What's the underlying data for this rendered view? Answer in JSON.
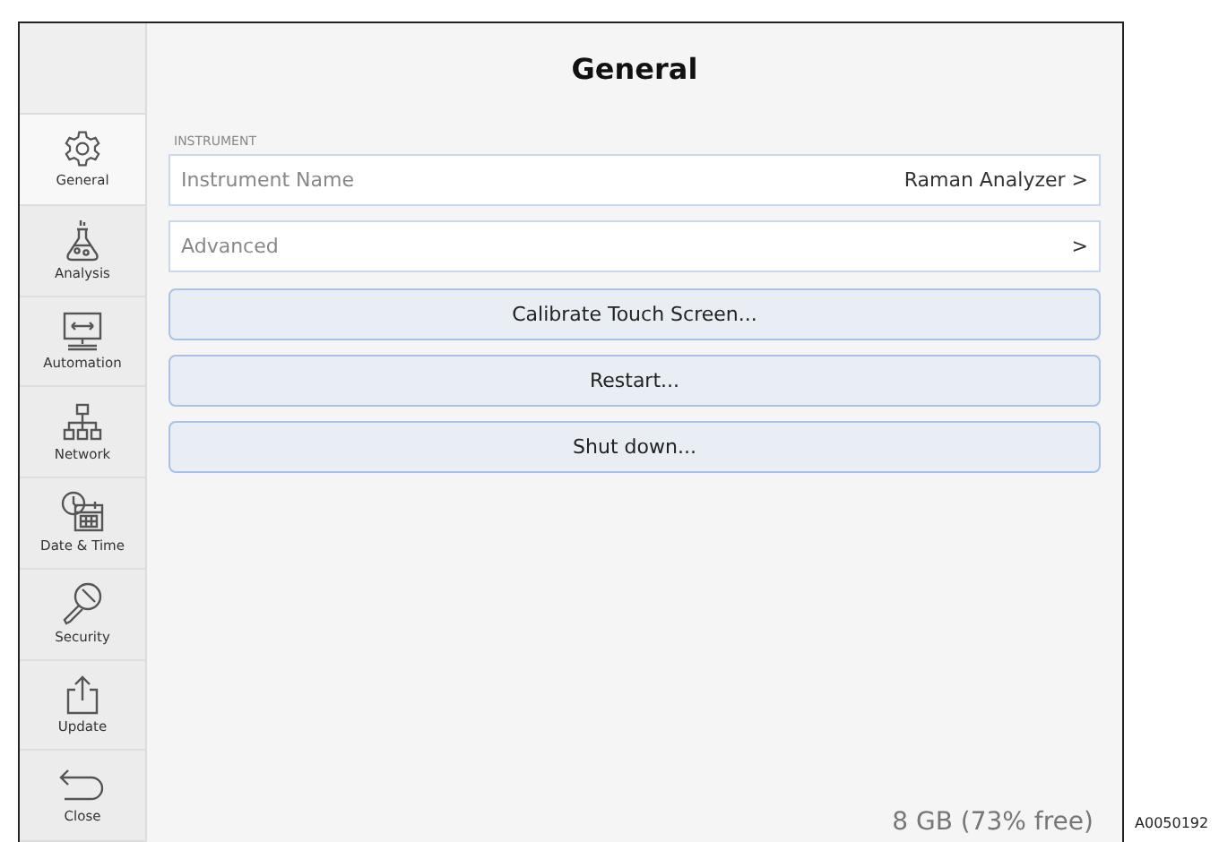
{
  "sidebar": {
    "items": [
      {
        "label": "General",
        "selected": true
      },
      {
        "label": "Analysis",
        "selected": false
      },
      {
        "label": "Automation",
        "selected": false
      },
      {
        "label": "Network",
        "selected": false
      },
      {
        "label": "Date & Time",
        "selected": false
      },
      {
        "label": "Security",
        "selected": false
      },
      {
        "label": "Update",
        "selected": false
      },
      {
        "label": "Close",
        "selected": false
      }
    ]
  },
  "title": "General",
  "section": "INSTRUMENT",
  "rows": [
    {
      "label": "Instrument Name",
      "value": "Raman Analyzer",
      "chevron": ">"
    },
    {
      "label": "Advanced",
      "chevron": ">"
    }
  ],
  "buttons": [
    "Calibrate Touch Screen...",
    "Restart...",
    "Shut down..."
  ],
  "storage": "8 GB (73% free)",
  "figure_code": "A0050192"
}
